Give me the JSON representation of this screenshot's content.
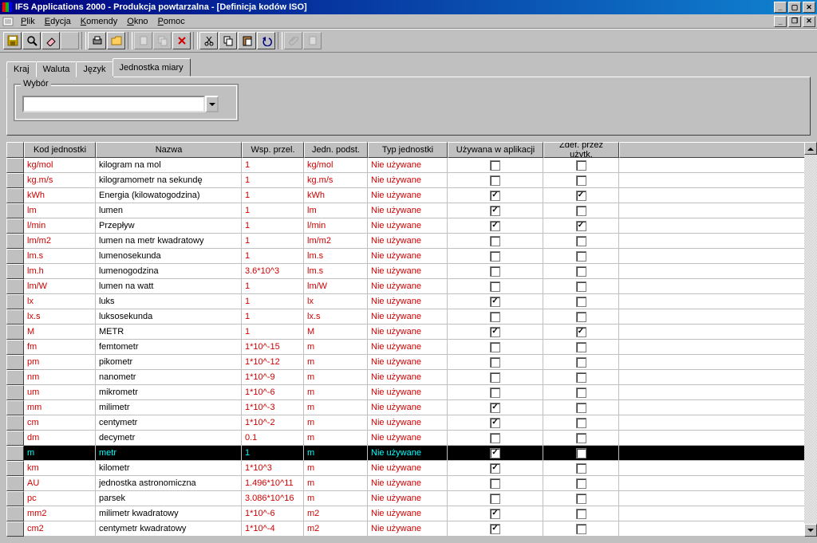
{
  "title": "IFS Applications 2000 - Produkcja powtarzalna - [Definicja kodów ISO]",
  "menu": {
    "plik": "Plik",
    "edycja": "Edycja",
    "komendy": "Komendy",
    "okno": "Okno",
    "pomoc": "Pomoc"
  },
  "tabs": {
    "kraj": "Kraj",
    "waluta": "Waluta",
    "jezyk": "Język",
    "jednostka": "Jednostka miary"
  },
  "groupbox": {
    "legend": "Wybór"
  },
  "columns": {
    "c1": "Kod jednostki",
    "c2": "Nazwa",
    "c3": "Wsp. przel.",
    "c4": "Jedn. podst.",
    "c5": "Typ jednostki",
    "c6": "Używana w aplikacji",
    "c7": "Zdef. przez użytk."
  },
  "nie_uzywane": "Nie używane",
  "rows": [
    {
      "code": "kg/mol",
      "name": "kilogram na mol",
      "factor": "1",
      "base": "kg/mol",
      "used": false,
      "def": false
    },
    {
      "code": "kg.m/s",
      "name": "kilogramometr na sekundę",
      "factor": "1",
      "base": "kg.m/s",
      "used": false,
      "def": false
    },
    {
      "code": "kWh",
      "name": "Energia (kilowatogodzina)",
      "factor": "1",
      "base": "kWh",
      "used": true,
      "def": true
    },
    {
      "code": "lm",
      "name": "lumen",
      "factor": "1",
      "base": "lm",
      "used": true,
      "def": false
    },
    {
      "code": "l/min",
      "name": "Przepływ",
      "factor": "1",
      "base": "l/min",
      "used": true,
      "def": true
    },
    {
      "code": "lm/m2",
      "name": "lumen na metr kwadratowy",
      "factor": "1",
      "base": "lm/m2",
      "used": false,
      "def": false
    },
    {
      "code": "lm.s",
      "name": "lumenosekunda",
      "factor": "1",
      "base": "lm.s",
      "used": false,
      "def": false
    },
    {
      "code": "lm.h",
      "name": "lumenogodzina",
      "factor": "3.6*10^3",
      "base": "lm.s",
      "used": false,
      "def": false
    },
    {
      "code": "lm/W",
      "name": "lumen na watt",
      "factor": "1",
      "base": "lm/W",
      "used": false,
      "def": false
    },
    {
      "code": "lx",
      "name": "luks",
      "factor": "1",
      "base": "lx",
      "used": true,
      "def": false
    },
    {
      "code": "lx.s",
      "name": "luksosekunda",
      "factor": "1",
      "base": "lx.s",
      "used": false,
      "def": false
    },
    {
      "code": "M",
      "name": "METR",
      "factor": "1",
      "base": "M",
      "used": true,
      "def": true
    },
    {
      "code": "fm",
      "name": "femtometr",
      "factor": "1*10^-15",
      "base": "m",
      "used": false,
      "def": false
    },
    {
      "code": "pm",
      "name": "pikometr",
      "factor": "1*10^-12",
      "base": "m",
      "used": false,
      "def": false
    },
    {
      "code": "nm",
      "name": "nanometr",
      "factor": "1*10^-9",
      "base": "m",
      "used": false,
      "def": false
    },
    {
      "code": "um",
      "name": "mikrometr",
      "factor": "1*10^-6",
      "base": "m",
      "used": false,
      "def": false
    },
    {
      "code": "mm",
      "name": "milimetr",
      "factor": "1*10^-3",
      "base": "m",
      "used": true,
      "def": false
    },
    {
      "code": "cm",
      "name": "centymetr",
      "factor": "1*10^-2",
      "base": "m",
      "used": true,
      "def": false
    },
    {
      "code": "dm",
      "name": "decymetr",
      "factor": "0.1",
      "base": "m",
      "used": false,
      "def": false
    },
    {
      "code": "m",
      "name": "metr",
      "factor": "1",
      "base": "m",
      "used": true,
      "def": false,
      "selected": true
    },
    {
      "code": "km",
      "name": "kilometr",
      "factor": "1*10^3",
      "base": "m",
      "used": true,
      "def": false
    },
    {
      "code": "AU",
      "name": "jednostka astronomiczna",
      "factor": "1.496*10^11",
      "base": "m",
      "used": false,
      "def": false
    },
    {
      "code": "pc",
      "name": "parsek",
      "factor": "3.086*10^16",
      "base": "m",
      "used": false,
      "def": false
    },
    {
      "code": "mm2",
      "name": "milimetr kwadratowy",
      "factor": "1*10^-6",
      "base": "m2",
      "used": true,
      "def": false
    },
    {
      "code": "cm2",
      "name": "centymetr kwadratowy",
      "factor": "1*10^-4",
      "base": "m2",
      "used": true,
      "def": false
    }
  ]
}
